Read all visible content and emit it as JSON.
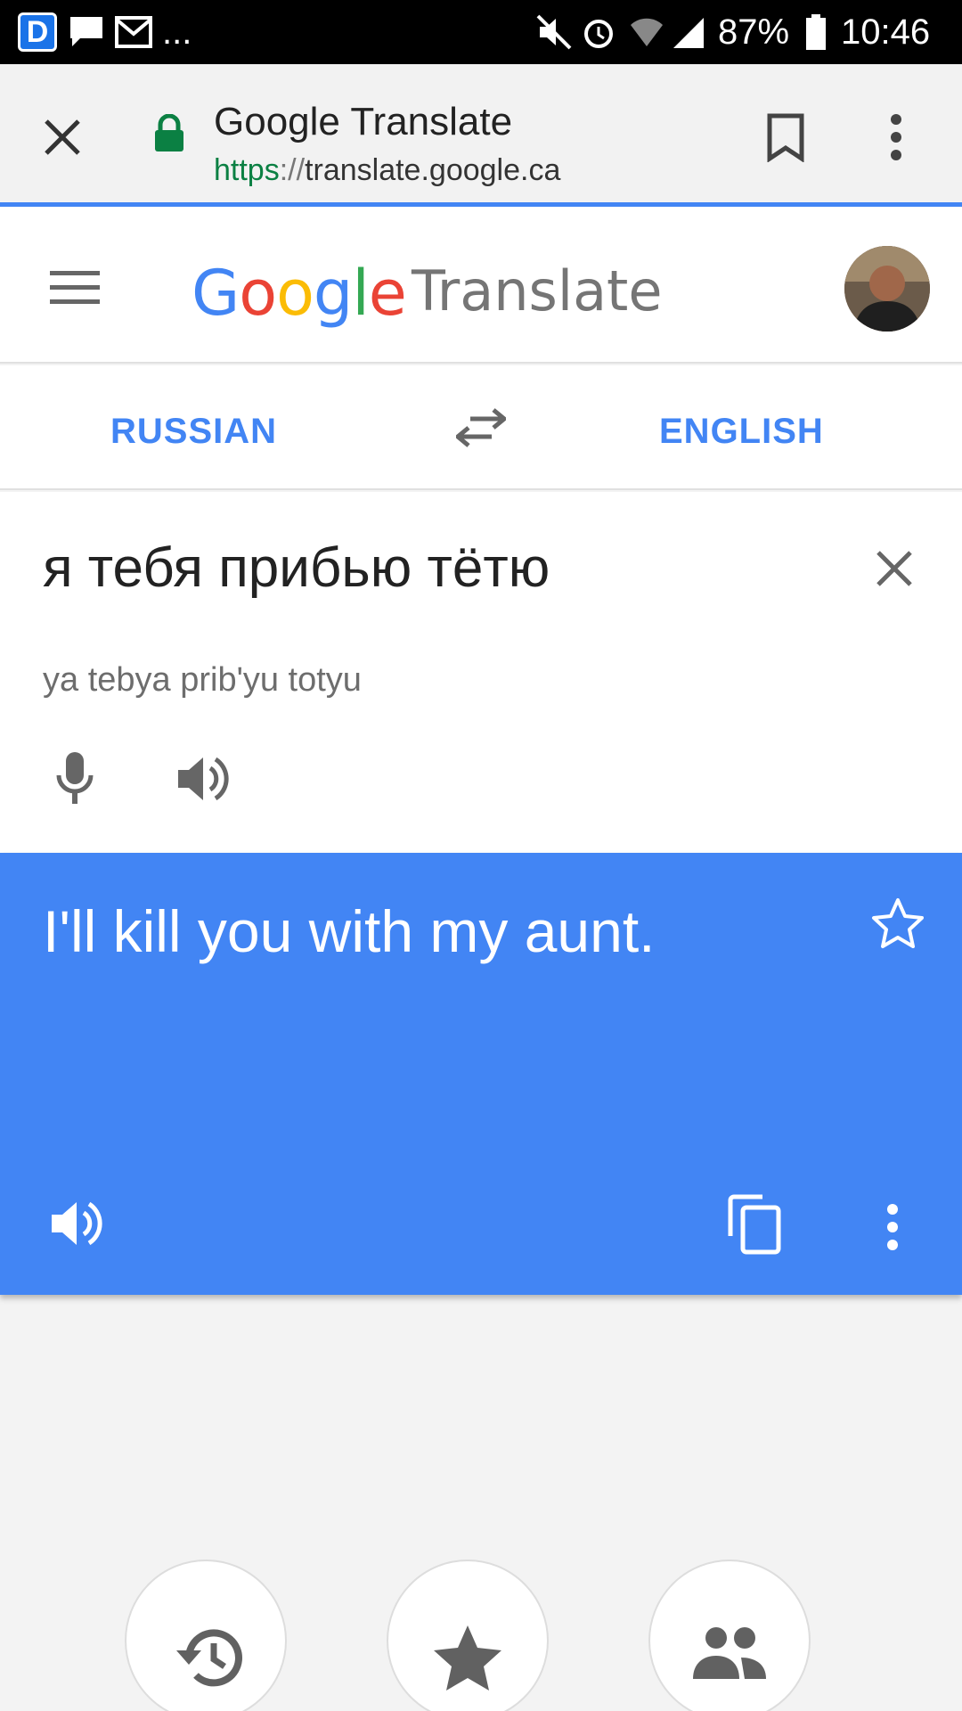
{
  "status_bar": {
    "app_badge": "D",
    "more": "...",
    "battery": "87%",
    "time": "10:46"
  },
  "browser": {
    "page_title": "Google Translate",
    "url_scheme": "https",
    "url_sep": "://",
    "url_host": "translate.google.ca"
  },
  "header": {
    "logo_letters": [
      "G",
      "o",
      "o",
      "g",
      "l",
      "e"
    ],
    "logo_colors": [
      "#4285f4",
      "#ea4335",
      "#fbbc05",
      "#4285f4",
      "#34a853",
      "#ea4335"
    ],
    "product_name": "Translate"
  },
  "languages": {
    "source": "RUSSIAN",
    "target": "ENGLISH"
  },
  "source": {
    "text": "я тебя прибью тётю",
    "transliteration": "ya tebya prib'yu totyu"
  },
  "result": {
    "text": "I'll kill you with my aunt."
  },
  "colors": {
    "accent": "#4285f4",
    "lock_green": "#0b8043",
    "icon_gray": "#616161"
  },
  "icons": {
    "bottom": [
      "history-icon",
      "phrasebook-star-icon",
      "community-icon"
    ]
  }
}
